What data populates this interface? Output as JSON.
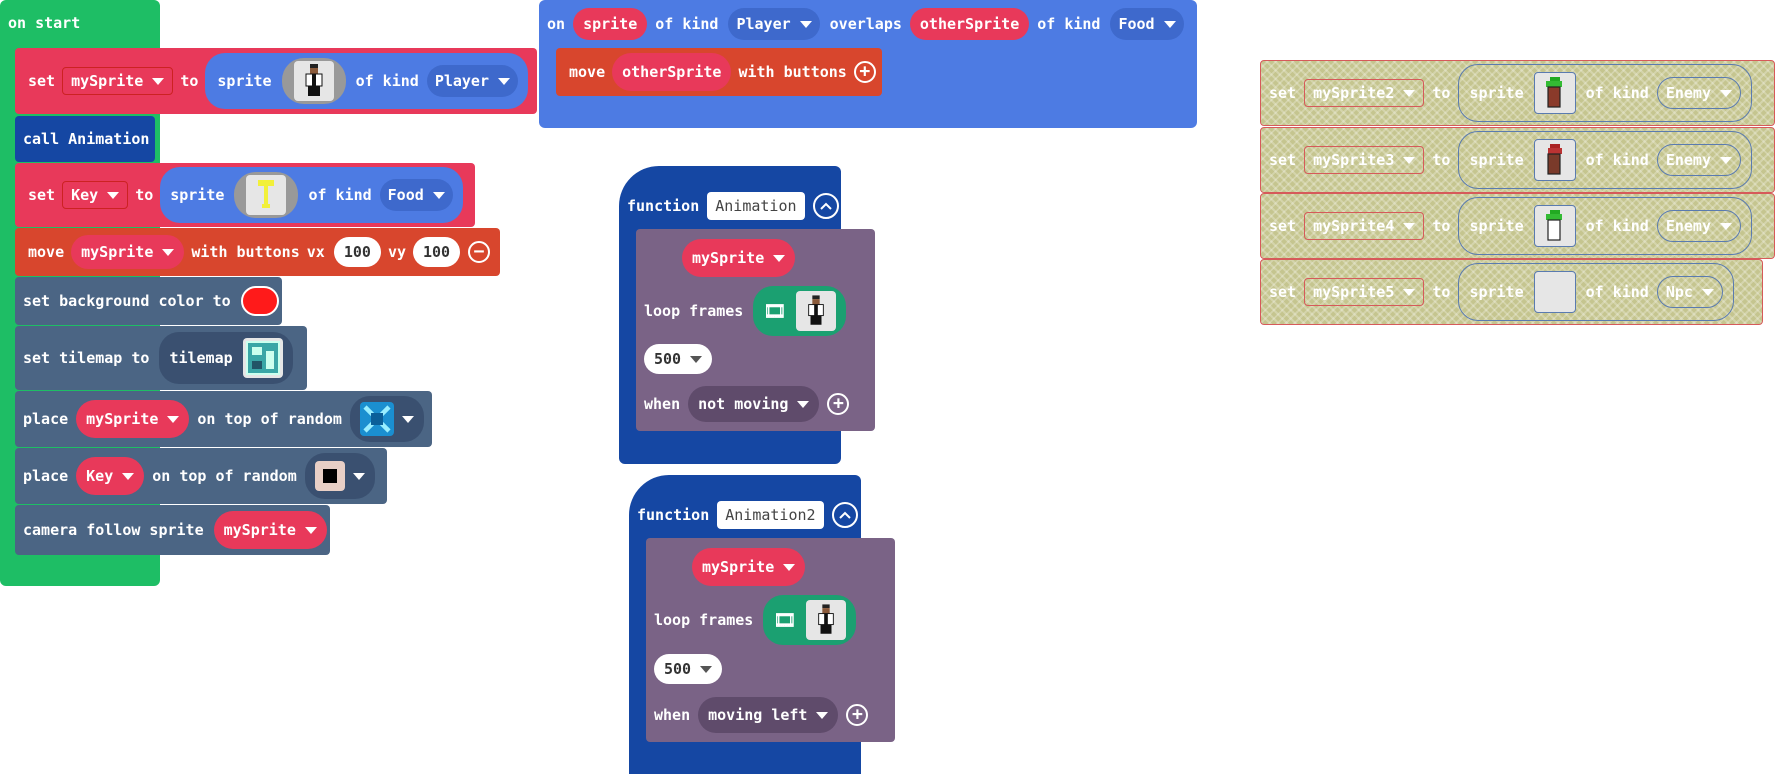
{
  "on_start": {
    "hat_label": "on start",
    "set1": {
      "set": "set",
      "var": "mySprite",
      "to": "to",
      "sprite": "sprite",
      "of_kind": "of kind",
      "kind": "Player"
    },
    "call": {
      "label": "call",
      "name": "Animation"
    },
    "set2": {
      "set": "set",
      "var": "Key",
      "to": "to",
      "sprite": "sprite",
      "of_kind": "of kind",
      "kind": "Food"
    },
    "move": {
      "move": "move",
      "var": "mySprite",
      "with_buttons": "with buttons",
      "vx_label": "vx",
      "vx": "100",
      "vy_label": "vy",
      "vy": "100"
    },
    "bg": {
      "label": "set background color to",
      "color": "#ff1a1a"
    },
    "tilemap": {
      "label": "set tilemap to",
      "value": "tilemap"
    },
    "place1": {
      "place": "place",
      "var": "mySprite",
      "rest": "on top of random"
    },
    "place2": {
      "place": "place",
      "var": "Key",
      "rest": "on top of random"
    },
    "camera": {
      "label": "camera follow sprite",
      "var": "mySprite"
    }
  },
  "overlap": {
    "on": "on",
    "sprite": "sprite",
    "of_kind": "of kind",
    "kind1": "Player",
    "overlaps": "overlaps",
    "other": "otherSprite",
    "of_kind2": "of kind",
    "kind2": "Food",
    "move": "move",
    "move_var": "otherSprite",
    "with_buttons": "with buttons"
  },
  "func1": {
    "function": "function",
    "name": "Animation",
    "sprite": "mySprite",
    "loop_frames": "loop frames",
    "interval": "500",
    "when": "when",
    "condition": "not moving"
  },
  "func2": {
    "function": "function",
    "name": "Animation2",
    "sprite": "mySprite",
    "loop_frames": "loop frames",
    "interval": "500",
    "when": "when",
    "condition": "moving left"
  },
  "enemies": [
    {
      "set": "set",
      "var": "mySprite2",
      "to": "to",
      "sprite": "sprite",
      "of_kind": "of kind",
      "kind": "Enemy"
    },
    {
      "set": "set",
      "var": "mySprite3",
      "to": "to",
      "sprite": "sprite",
      "of_kind": "of kind",
      "kind": "Enemy"
    },
    {
      "set": "set",
      "var": "mySprite4",
      "to": "to",
      "sprite": "sprite",
      "of_kind": "of kind",
      "kind": "Enemy"
    },
    {
      "set": "set",
      "var": "mySprite5",
      "to": "to",
      "sprite": "sprite",
      "of_kind": "of kind",
      "kind": "Npc"
    }
  ]
}
